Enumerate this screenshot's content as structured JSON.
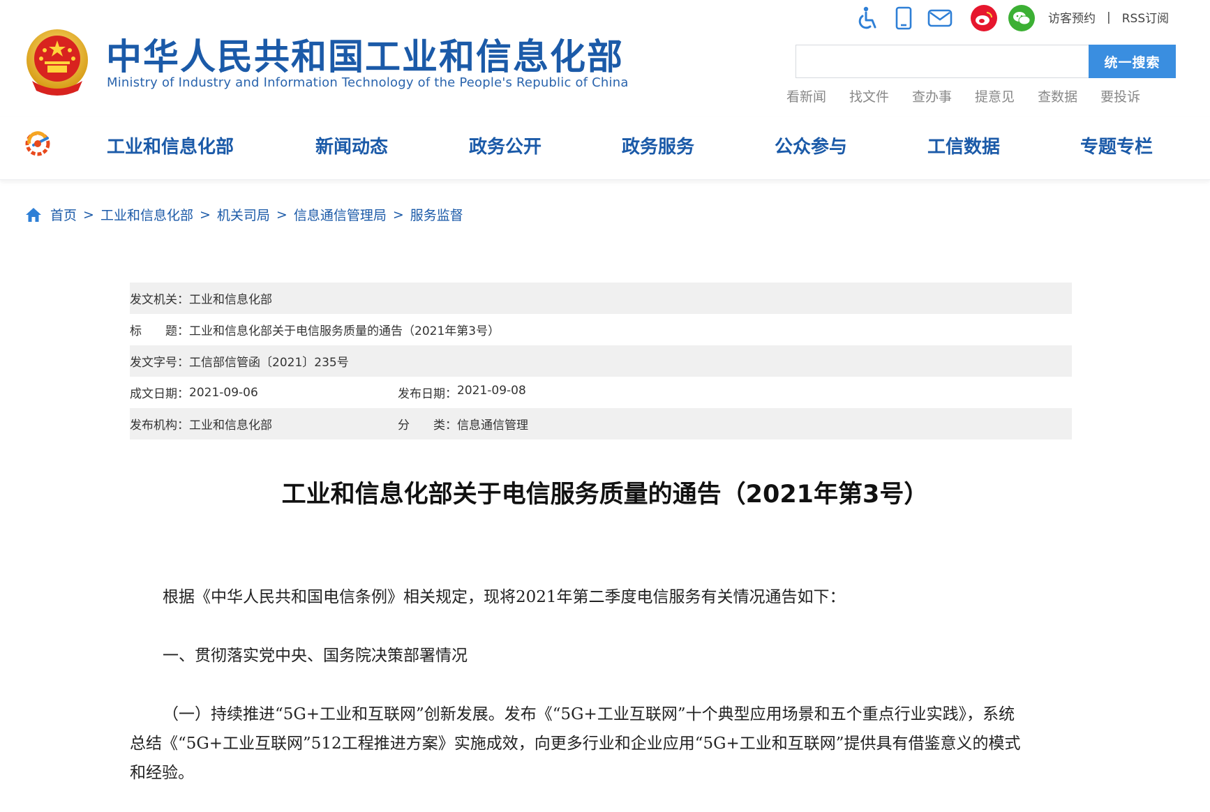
{
  "header": {
    "title": "中华人民共和国工业和信息化部",
    "subtitle": "Ministry of Industry and Information Technology of the People's Republic of China",
    "top_links": {
      "visit": "访客预约",
      "divider": "|",
      "rss": "RSS订阅"
    },
    "icons": [
      "accessibility-icon",
      "mobile-icon",
      "mail-icon",
      "weibo-icon",
      "wechat-icon"
    ],
    "search": {
      "value": "",
      "placeholder": "",
      "button": "统一搜索"
    },
    "quick_links": [
      "看新闻",
      "找文件",
      "查办事",
      "提意见",
      "查数据",
      "要投诉"
    ]
  },
  "nav": {
    "items": [
      "工业和信息化部",
      "新闻动态",
      "政务公开",
      "政务服务",
      "公众参与",
      "工信数据",
      "专题专栏"
    ]
  },
  "breadcrumb": {
    "separator": ">",
    "items": [
      "首页",
      "工业和信息化部",
      "机关司局",
      "信息通信管理局",
      "服务监督"
    ]
  },
  "meta": {
    "issuer_label": "发文机关：",
    "issuer": "工业和信息化部",
    "title_label": "标　　题：",
    "title": "工业和信息化部关于电信服务质量的通告（2021年第3号）",
    "doc_no_label": "发文字号：",
    "doc_no": "工信部信管函〔2021〕235号",
    "written_label": "成文日期：",
    "written": "2021-09-06",
    "published_label": "发布日期：",
    "published": "2021-09-08",
    "org_label": "发布机构：",
    "org": "工业和信息化部",
    "category_label": "分　　类：",
    "category": "信息通信管理"
  },
  "article": {
    "title": "工业和信息化部关于电信服务质量的通告（2021年第3号）",
    "p1": "根据《中华人民共和国电信条例》相关规定，现将2021年第二季度电信服务有关情况通告如下：",
    "h1": "一、贯彻落实党中央、国务院决策部署情况",
    "p2_line1": "（一）持续推进“5G+工业和互联网”创新发展。发布《“5G+工业互联网”十个典型应用场景和五个重点行业实践》，系统",
    "p2_line2": "总结《“5G+工业互联网”512工程推进方案》实施成效，向更多行业和企业应用“5G+工业和互联网”提供具有借鉴意义的模式",
    "p2_line3": "和经验。"
  },
  "colors": {
    "brand_blue": "#1b5aa8",
    "search_button": "#3a8ee0",
    "weibo": "#e6162d",
    "wechat": "#3cb034",
    "meta_shade": "#f0f0f0"
  }
}
